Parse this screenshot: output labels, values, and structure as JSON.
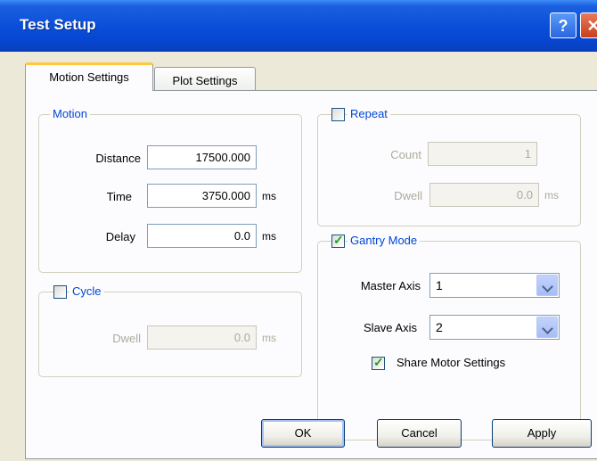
{
  "window": {
    "title": "Test Setup",
    "help_glyph": "?",
    "close_glyph": "✕"
  },
  "tabs": [
    {
      "label": "Motion Settings",
      "active": true
    },
    {
      "label": "Plot Settings",
      "active": false
    }
  ],
  "motion": {
    "legend": "Motion",
    "distance": {
      "label": "Distance",
      "value": "17500.000"
    },
    "time": {
      "label": "Time",
      "value": "3750.000",
      "unit": "ms"
    },
    "delay": {
      "label": "Delay",
      "value": "0.0",
      "unit": "ms"
    }
  },
  "cycle": {
    "legend": "Cycle",
    "checked": false,
    "dwell": {
      "label": "Dwell",
      "value": "0.0",
      "unit": "ms"
    }
  },
  "repeat": {
    "legend": "Repeat",
    "checked": false,
    "count": {
      "label": "Count",
      "value": "1"
    },
    "dwell": {
      "label": "Dwell",
      "value": "0.0",
      "unit": "ms"
    }
  },
  "gantry": {
    "legend": "Gantry Mode",
    "checked": true,
    "master_axis": {
      "label": "Master Axis",
      "value": "1"
    },
    "slave_axis": {
      "label": "Slave Axis",
      "value": "2"
    },
    "share_motor": {
      "label": "Share Motor Settings",
      "checked": true
    }
  },
  "buttons": {
    "ok": "OK",
    "cancel": "Cancel",
    "apply": "Apply"
  },
  "colors": {
    "title_blue": "#0a4fd9",
    "group_label_blue": "#0046d5",
    "tab_highlight": "#ffc83c"
  }
}
